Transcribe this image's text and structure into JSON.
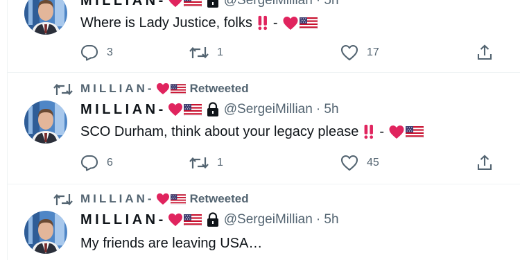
{
  "tweets": [
    {
      "retweeted_by": null,
      "author_name": "MILLIAN-",
      "author_handle": "@SergeiMillian",
      "time": "· 5h",
      "text": "Where is Lady Justice, folks",
      "text_suffix": "-",
      "replies": "3",
      "retweets": "1",
      "likes": "17"
    },
    {
      "retweeted_by": "MILLIAN-",
      "retweeted_label": "Retweeted",
      "author_name": "MILLIAN-",
      "author_handle": "@SergeiMillian",
      "time": "· 5h",
      "text": "SCO Durham, think about your legacy please",
      "text_suffix": "-",
      "replies": "6",
      "retweets": "1",
      "likes": "45"
    },
    {
      "retweeted_by": "MILLIAN-",
      "retweeted_label": "Retweeted",
      "author_name": "MILLIAN-",
      "author_handle": "@SergeiMillian",
      "time": "· 5h",
      "text": "My friends are leaving USA…"
    }
  ],
  "colors": {
    "heart": "#e0245e",
    "muted": "#536471",
    "divider": "#eff3f4",
    "text": "#0f1419"
  },
  "icons": [
    "retweet-icon",
    "reply-icon",
    "like-icon",
    "share-icon",
    "heart-emoji",
    "us-flag-emoji",
    "lock-icon",
    "double-exclamation-emoji"
  ]
}
